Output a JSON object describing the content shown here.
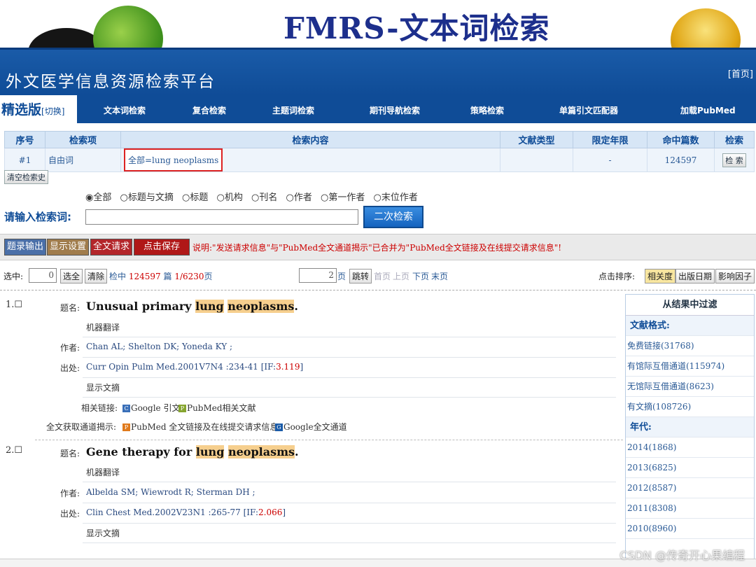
{
  "slide": {
    "title": "FMRS-文本词检索"
  },
  "platform": {
    "title": "外文医学信息资源检索平台",
    "home": "[首页]"
  },
  "edition": {
    "label": "精选版",
    "switch": "[切换]"
  },
  "nav": [
    "文本词检索",
    "复合检索",
    "主题词检索",
    "期刊导航检索",
    "策略检索",
    "单篇引文匹配器",
    "加载PubMed"
  ],
  "history": {
    "headers": [
      "序号",
      "检索项",
      "检索内容",
      "文献类型",
      "限定年限",
      "命中篇数",
      "检索"
    ],
    "row": {
      "num": "#1",
      "field": "自由词",
      "query": "全部=lung neoplasms",
      "doctype": "",
      "years": "-",
      "hits": "124597",
      "action": "检 索"
    },
    "clear": "清空检索史"
  },
  "scope_options": [
    "全部",
    "标题与文摘",
    "标题",
    "机构",
    "刊名",
    "作者",
    "第一作者",
    "末位作者"
  ],
  "scope_selected": "全部",
  "query": {
    "label": "请输入检索词:",
    "value": "",
    "button": "二次检索"
  },
  "actions": {
    "export": "题录输出",
    "display": "显示设置",
    "fulltext": "全文请求",
    "save": "点击保存",
    "notice": "说明:\"发送请求信息\"与\"PubMed全文通道揭示\"已合并为\"PubMed全文链接及在线提交请求信息\"!",
    "colors": {
      "export": "#4a6fa8",
      "display": "#a07c4c",
      "fulltext": "#b3262a",
      "save": "#b01818"
    }
  },
  "pager": {
    "selected_label": "选中:",
    "selected_value": "0",
    "select_all": "选全",
    "clear": "清除",
    "hits_text": "检中",
    "hits": "124597",
    "pages_unit": "篇",
    "page_info": "1/6230",
    "page_suffix": "页",
    "goto_value": "2",
    "goto_unit": "页",
    "goto_button": "跳转",
    "first": "首页",
    "prev": "上页",
    "next": "下页",
    "last": "末页",
    "sort_label": "点击排序:",
    "sort_options": [
      "相关度",
      "出版日期",
      "影响因子"
    ]
  },
  "records": [
    {
      "num": "1.",
      "title_pre": "Unusual primary ",
      "title_hl1": "lung",
      "title_hl2": "neoplasms",
      "title_post": ".",
      "machine_translate": "机器翻译",
      "authors": "Chan AL;  Shelton DK;  Yoneda KY ;",
      "source": "Curr Opin Pulm Med.2001V7N4 :234-41",
      "if_label": "[IF:",
      "if_value": "3.119",
      "if_close": "]",
      "show_abstract": "显示文摘",
      "related_google": "Google 引文",
      "related_pubmed": "PubMed相关文献",
      "fulltext_pubmed": "PubMed 全文链接及在线提交请求信息",
      "fulltext_google": "Google全文通道"
    },
    {
      "num": "2.",
      "title_pre": "Gene therapy for ",
      "title_hl1": "lung",
      "title_hl2": "neoplasms",
      "title_post": ".",
      "machine_translate": "机器翻译",
      "authors": "Albelda SM;  Wiewrodt R;  Sterman DH ;",
      "source": "Clin Chest Med.2002V23N1 :265-77",
      "if_label": "[IF:",
      "if_value": "2.066",
      "if_close": "]",
      "show_abstract": "显示文摘"
    }
  ],
  "record_labels": {
    "title": "题名:",
    "author": "作者:",
    "source": "出处:",
    "related": "相关链接:",
    "fulltext": "全文获取通道揭示:"
  },
  "filter": {
    "title": "从结果中过滤",
    "format_label": "文献格式:",
    "formats": [
      "免费链接(31768)",
      "有馆际互借通道(115974)",
      "无馆际互借通道(8623)",
      "有文摘(108726)"
    ],
    "year_label": "年代:",
    "years": [
      "2014(1868)",
      "2013(6825)",
      "2012(8587)",
      "2011(8308)",
      "2010(8960)"
    ]
  },
  "watermark": "CSDN @传奇开心果编程"
}
